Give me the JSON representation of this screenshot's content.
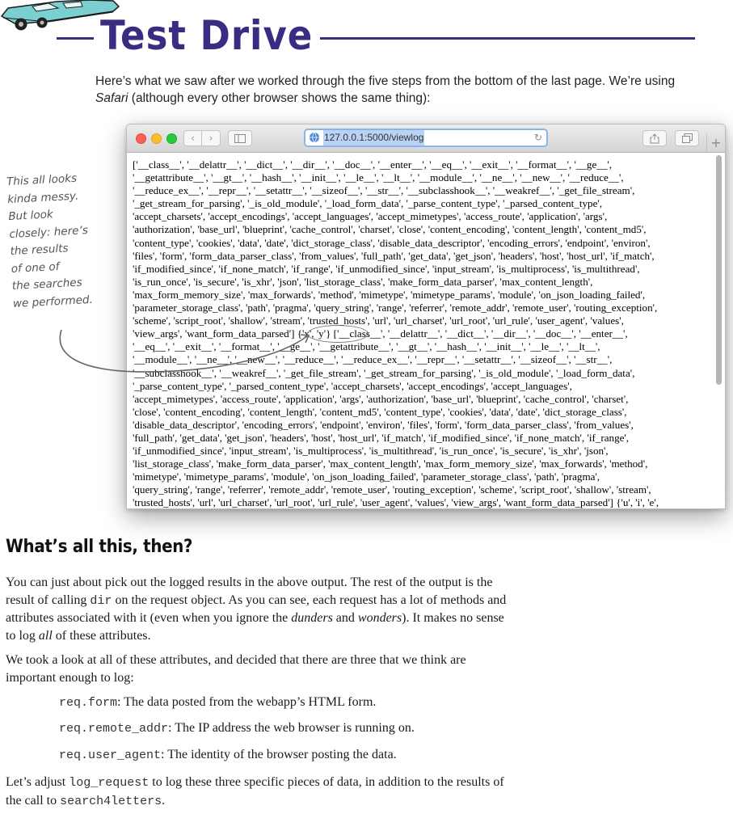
{
  "header": {
    "title": "Test Drive",
    "intro_pre": "Here’s what we saw after we worked through the five steps from the bottom of the last page. We’re using ",
    "intro_browser": "Safari",
    "intro_post": " (although every other browser shows the same thing):",
    "illustration": "car-icon"
  },
  "note": {
    "lines": [
      "This all looks",
      "kinda messy.",
      "But look",
      "closely: here’s",
      "the results",
      "of one of",
      "the searches",
      "we performed."
    ]
  },
  "browser": {
    "name": "Safari",
    "url": "127.0.0.1:5000/viewlog",
    "lines": [
      "['__class__', '__delattr__', '__dict__', '__dir__', '__doc__', '__enter__', '__eq__', '__exit__', '__format__', '__ge__',",
      "'__getattribute__', '__gt__', '__hash__', '__init__', '__le__', '__lt__', '__module__', '__ne__', '__new__', '__reduce__',",
      "'__reduce_ex__', '__repr__', '__setattr__', '__sizeof__', '__str__', '__subclasshook__', '__weakref__', '_get_file_stream',",
      "'_get_stream_for_parsing', '_is_old_module', '_load_form_data', '_parse_content_type', '_parsed_content_type',",
      "'accept_charsets', 'accept_encodings', 'accept_languages', 'accept_mimetypes', 'access_route', 'application', 'args',",
      "'authorization', 'base_url', 'blueprint', 'cache_control', 'charset', 'close', 'content_encoding', 'content_length', 'content_md5',",
      "'content_type', 'cookies', 'data', 'date', 'dict_storage_class', 'disable_data_descriptor', 'encoding_errors', 'endpoint', 'environ',",
      "'files', 'form', 'form_data_parser_class', 'from_values', 'full_path', 'get_data', 'get_json', 'headers', 'host', 'host_url', 'if_match',",
      "'if_modified_since', 'if_none_match', 'if_range', 'if_unmodified_since', 'input_stream', 'is_multiprocess', 'is_multithread',",
      "'is_run_once', 'is_secure', 'is_xhr', 'json', 'list_storage_class', 'make_form_data_parser', 'max_content_length',",
      "'max_form_memory_size', 'max_forwards', 'method', 'mimetype', 'mimetype_params', 'module', 'on_json_loading_failed',",
      "'parameter_storage_class', 'path', 'pragma', 'query_string', 'range', 'referrer', 'remote_addr', 'remote_user', 'routing_exception',",
      "'scheme', 'script_root', 'shallow', 'stream', 'trusted_hosts', 'url', 'url_charset', 'url_root', 'url_rule', 'user_agent', 'values',",
      "'view_args', 'want_form_data_parsed'] {'x', 'y'} ['__class__', '__delattr__', '__dict__', '__dir__', '__doc__', '__enter__',",
      "'__eq__', '__exit__', '__format__', '__ge__', '__getattribute__', '__gt__', '__hash__', '__init__', '__le__', '__lt__',",
      "'__module__', '__ne__', '__new__', '__reduce__', '__reduce_ex__', '__repr__', '__setattr__', '__sizeof__', '__str__',",
      "'__subclasshook__', '__weakref__', '_get_file_stream', '_get_stream_for_parsing', '_is_old_module', '_load_form_data',",
      "'_parse_content_type', '_parsed_content_type', 'accept_charsets', 'accept_encodings', 'accept_languages',",
      "'accept_mimetypes', 'access_route', 'application', 'args', 'authorization', 'base_url', 'blueprint', 'cache_control', 'charset',",
      "'close', 'content_encoding', 'content_length', 'content_md5', 'content_type', 'cookies', 'data', 'date', 'dict_storage_class',",
      "'disable_data_descriptor', 'encoding_errors', 'endpoint', 'environ', 'files', 'form', 'form_data_parser_class', 'from_values',",
      "'full_path', 'get_data', 'get_json', 'headers', 'host', 'host_url', 'if_match', 'if_modified_since', 'if_none_match', 'if_range',",
      "'if_unmodified_since', 'input_stream', 'is_multiprocess', 'is_multithread', 'is_run_once', 'is_secure', 'is_xhr', 'json',",
      "'list_storage_class', 'make_form_data_parser', 'max_content_length', 'max_form_memory_size', 'max_forwards', 'method',",
      "'mimetype', 'mimetype_params', 'module', 'on_json_loading_failed', 'parameter_storage_class', 'path', 'pragma',",
      "'query_string', 'range', 'referrer', 'remote_addr', 'remote_user', 'routing_exception', 'scheme', 'script_root', 'shallow', 'stream',",
      "'trusted_hosts', 'url', 'url_charset', 'url_root', 'url_rule', 'user_agent', 'values', 'view_args', 'want_form_data_parsed'] {'u', 'i', 'e',"
    ]
  },
  "section": {
    "heading": "What’s all this, then?",
    "p1": {
      "a": "You can just about pick out the logged results in the above output. The rest of the output is the result of calling ",
      "code": "dir",
      "b": " on the request object. As you can see, each request has a lot of methods and attributes associated with it (even when you ignore the ",
      "em1": "dunders",
      "c": " and ",
      "em2": "wonders",
      "d": "). It makes no sense to log ",
      "em3": "all",
      "e": " of these attributes."
    },
    "p2": "We took a look at all of these attributes, and decided that there are three that we think are important enough to log:",
    "items": [
      {
        "code": "req.form",
        "text": ": The data posted from the webapp’s HTML form."
      },
      {
        "code": "req.remote_addr",
        "text": ": The IP address the web browser is running on."
      },
      {
        "code": "req.user_agent",
        "text": ": The identity of the browser posting the data."
      }
    ],
    "p3": {
      "a": "Let’s adjust ",
      "code1": "log_request",
      "b": " to log these three specific pieces of data, in addition to the results of the call to ",
      "code2": "search4letters",
      "c": "."
    }
  },
  "colors": {
    "title": "#3b2b82",
    "car": "#7ccfd0",
    "url_highlight": "#b9d3f5",
    "address_focus": "#8db3ea"
  }
}
